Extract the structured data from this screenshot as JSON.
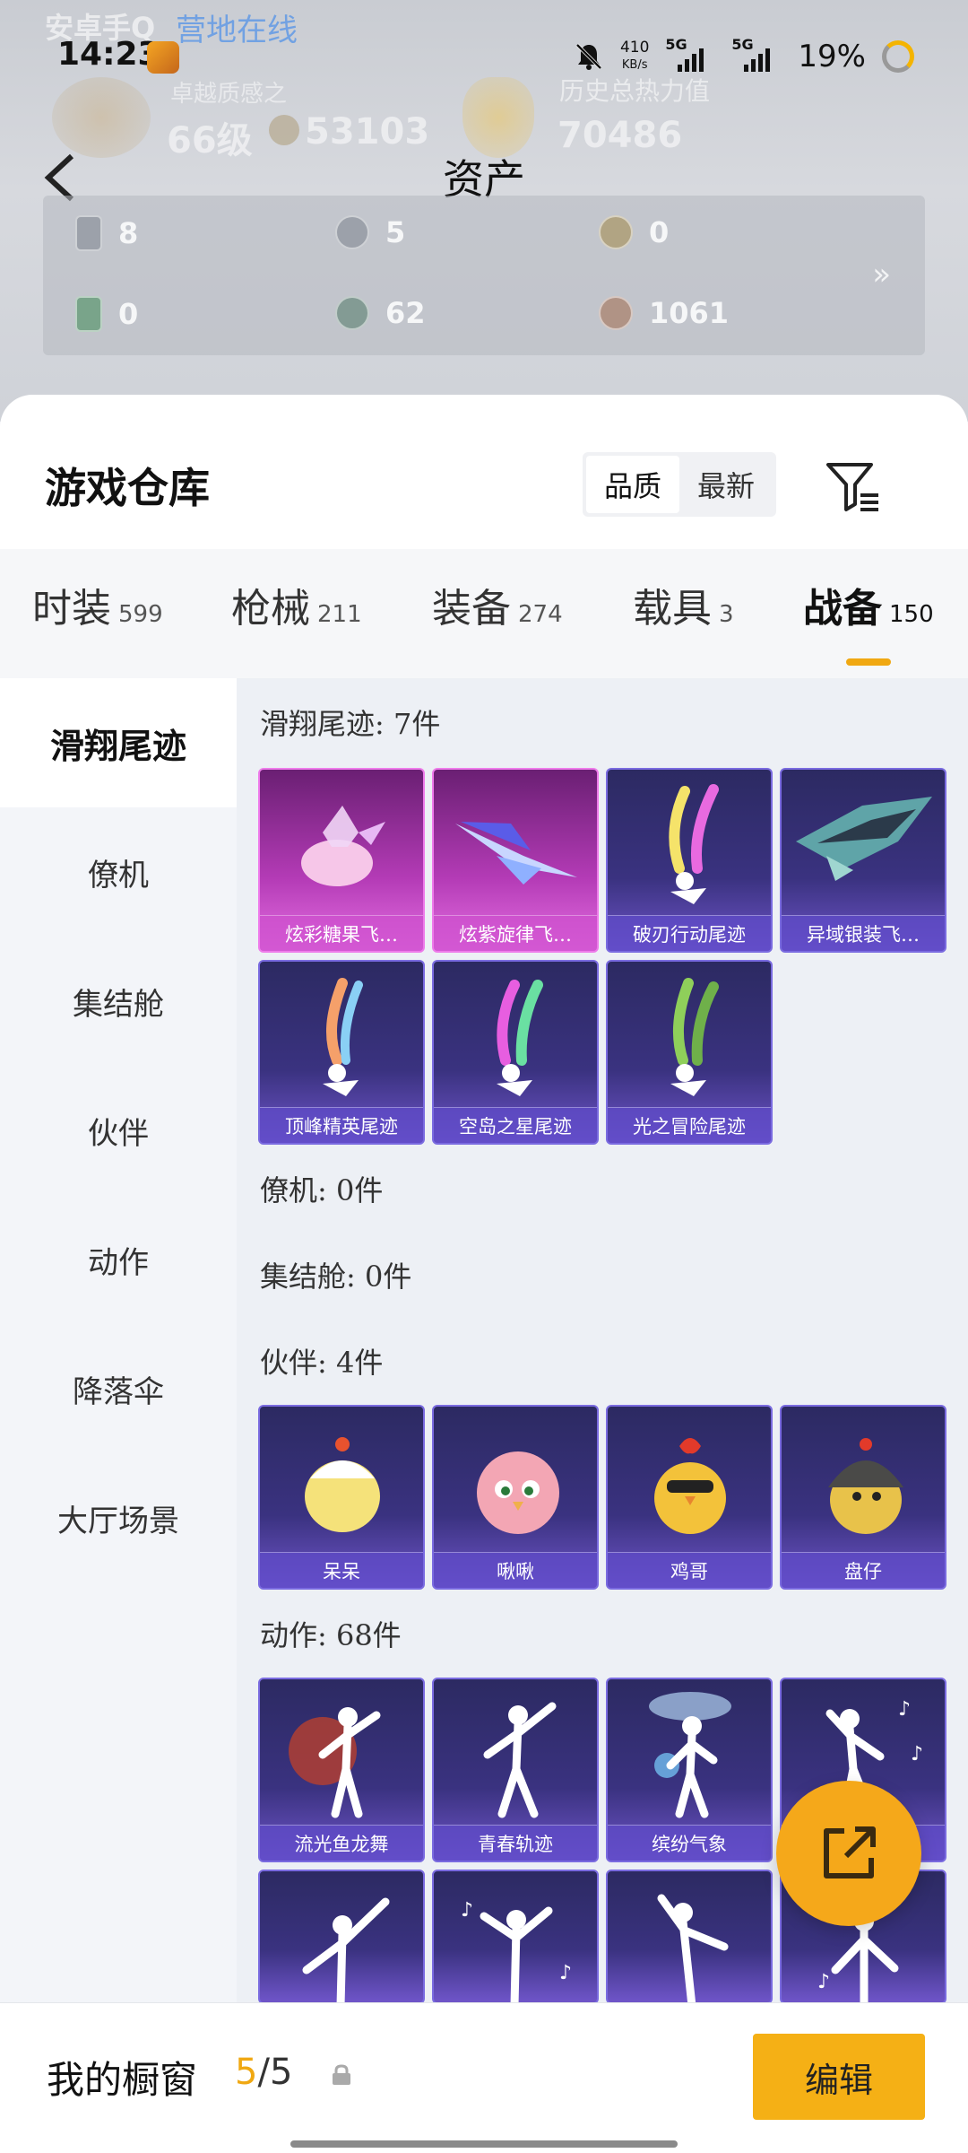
{
  "status_bar": {
    "time": "14:23",
    "net_speed_value": "410",
    "net_speed_unit": "KB/s",
    "sim1": "5G",
    "sim2": "5G",
    "battery": "19%"
  },
  "header": {
    "ghost_online": "营地在线",
    "ghost_left": "安卓手Q",
    "ghost_rank_label": "卓越质感之",
    "ghost_level": "66级",
    "ghost_score": "53103",
    "ghost_power_label": "历史总热力值",
    "ghost_power": "70486",
    "title": "资产"
  },
  "assets": [
    {
      "icon": "card-icon",
      "value": "8"
    },
    {
      "icon": "coin-silver-icon",
      "value": "5"
    },
    {
      "icon": "coin-gold-icon",
      "value": "0"
    },
    {
      "icon": "ticket-icon",
      "value": "0"
    },
    {
      "icon": "gem-icon",
      "value": "62"
    },
    {
      "icon": "bronze-coin-icon",
      "value": "1061"
    }
  ],
  "warehouse": {
    "title": "游戏仓库",
    "sort_options": [
      "品质",
      "最新"
    ],
    "active_sort": "品质"
  },
  "categories": [
    {
      "name": "时装",
      "count": "599"
    },
    {
      "name": "枪械",
      "count": "211"
    },
    {
      "name": "装备",
      "count": "274"
    },
    {
      "name": "载具",
      "count": "3"
    },
    {
      "name": "战备",
      "count": "150"
    }
  ],
  "active_category": "战备",
  "sidebar": [
    {
      "label": "滑翔尾迹"
    },
    {
      "label": "僚机"
    },
    {
      "label": "集结舱"
    },
    {
      "label": "伙伴"
    },
    {
      "label": "动作"
    },
    {
      "label": "降落伞"
    },
    {
      "label": "大厅场景"
    }
  ],
  "sections": {
    "trail": {
      "header": "滑翔尾迹: 7件",
      "items": [
        "炫彩糖果飞…",
        "炫紫旋律飞…",
        "破刃行动尾迹",
        "异域银装飞…",
        "顶峰精英尾迹",
        "空岛之星尾迹",
        "光之冒险尾迹"
      ]
    },
    "wingman": {
      "header": "僚机: 0件"
    },
    "pod": {
      "header": "集结舱: 0件"
    },
    "partner": {
      "header": "伙伴: 4件",
      "items": [
        "呆呆",
        "啾啾",
        "鸡哥",
        "盘仔"
      ]
    },
    "emote": {
      "header": "动作: 68件",
      "items": [
        "流光鱼龙舞",
        "青春轨迹",
        "缤纷气象",
        ""
      ]
    }
  },
  "bottom_bar": {
    "title": "我的橱窗",
    "current": "5",
    "separator": "/",
    "total": "5",
    "edit_label": "编辑"
  },
  "colors": {
    "accent": "#f5b015",
    "card_purple": "#3a3280",
    "card_pink": "#b43bb6"
  }
}
